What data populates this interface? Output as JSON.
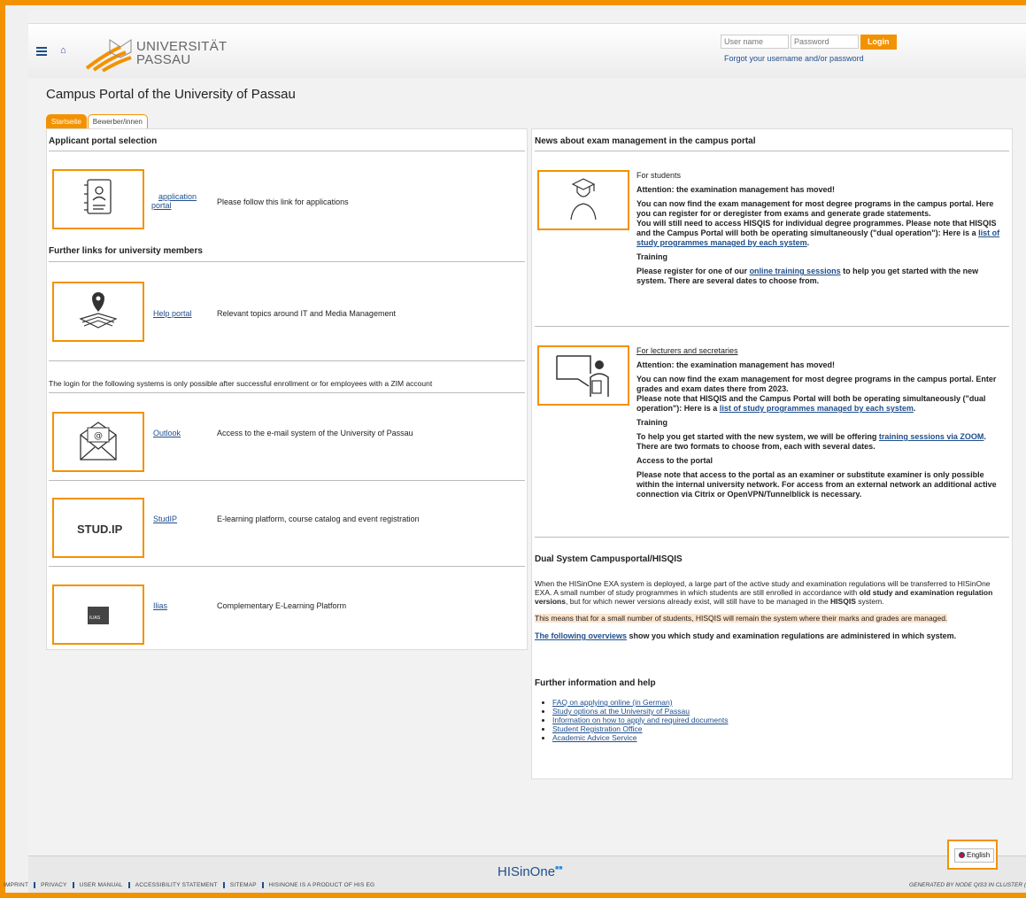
{
  "header": {
    "logo_text_line1": "UNIVERSITÄT",
    "logo_text_line2": "PASSAU",
    "username_placeholder": "User name",
    "password_placeholder": "Password",
    "login_label": "Login",
    "forgot_link": "Forgot your username and/or password"
  },
  "page_title": "Campus Portal of the University of Passau",
  "tabs": [
    {
      "label": "Startseite",
      "active": true
    },
    {
      "label": "Bewerber/innen",
      "active": false
    }
  ],
  "left": {
    "applicant_title": "Applicant portal selection",
    "application_link_line1": "application",
    "application_link_line2": "portal",
    "application_desc": "Please follow this link for applications",
    "further_title": "Further links for university members",
    "help_link": "Help portal",
    "help_desc": "Relevant topics around IT and Media Management",
    "login_note": "The login for the following systems is only possible after successful enrollment or for employees with a ZIM account",
    "outlook_link": "Outlook",
    "outlook_desc": "Access to the e-mail system of the University of Passau",
    "studip_logo": "STUD.IP",
    "studip_link": "StudIP",
    "studip_desc": "E-learning platform, course catalog and event registration",
    "ilias_logo": "ILIAS",
    "ilias_link": "Ilias",
    "ilias_desc": "Complementary E-Learning Platform"
  },
  "right": {
    "news_title": "News about exam management in the campus portal",
    "students": {
      "heading": "For students",
      "attention": "Attention: the examination management has moved!",
      "p1": "You can now find the exam management for most degree programs in the campus portal. Here you can register for or deregister from exams and generate grade statements.",
      "p2_before": "You will still need to access HISQIS for individual degree programmes. Please note that HISQIS and the Campus Portal will both be operating simultaneously (\"dual operation\"): Here is a",
      "p2_link": "list of study programmes managed by each system",
      "p2_after": ".",
      "training_heading": "Training",
      "training_before": "Please register for one of our",
      "training_link": "online training sessions",
      "training_after": "to help you get started with the new system. There are several dates to choose from."
    },
    "lecturers": {
      "heading": "For lecturers and secretaries",
      "attention": "Attention: the examination management has moved!",
      "p1": "You can now find the exam management for most degree programs in the campus portal. Enter grades and exam dates there from 2023.",
      "p2_before": "Please note that HISQIS and the Campus Portal will both be operating simultaneously (\"dual operation\"): Here is a",
      "p2_link": "list of study programmes managed by each system",
      "p2_after": ".",
      "training_heading": "Training",
      "training_before": "To help you get started with the new system, we will be offering",
      "training_link": "training sessions via ZOOM",
      "training_after": ". There are two formats to choose from, each with several dates.",
      "access_heading": "Access to the portal",
      "access_text": "Please note that access to the portal as an examiner or substitute examiner is only possible within the internal university network. For access from an external network an additional active connection via Citrix or OpenVPN/Tunnelblick is necessary."
    },
    "dual": {
      "title": "Dual System Campusportal/HISQIS",
      "p1_a": "When the HISinOne EXA system is deployed, a large part of the active study and examination regulations will be transferred to HISinOne EXA. A small number of study programmes in which students are still enrolled in accordance with",
      "p1_b": "old study and examination regulation versions",
      "p1_c": ", but for which newer versions already exist, will still have to be managed in the",
      "p1_d": "HISQIS",
      "p1_e": "system.",
      "highlight": "This means that for a small number of students, HISQIS will remain the system where their marks and grades are managed.",
      "overview_link": "The following overviews",
      "overview_after": "show you which study and examination regulations are administered in which system."
    },
    "help": {
      "title": "Further information and help",
      "items": [
        "FAQ on applying online (in German)",
        "Study options at the University of Passau",
        "Information on how to apply and required documents",
        "Student Registration Office",
        "Academic Advice Service"
      ]
    }
  },
  "footer": {
    "brand": "HISinOne",
    "links": [
      "IMPRINT",
      "PRIVACY",
      "USER MANUAL",
      "ACCESSIBILITY STATEMENT",
      "SITEMAP",
      "HISINONE IS A PRODUCT OF HIS EG"
    ],
    "generated": "GENERATED BY NODE QIS3 IN CLUSTER (",
    "language": "English"
  },
  "colors": {
    "accent": "#f39200",
    "link": "#1f4e8c"
  }
}
